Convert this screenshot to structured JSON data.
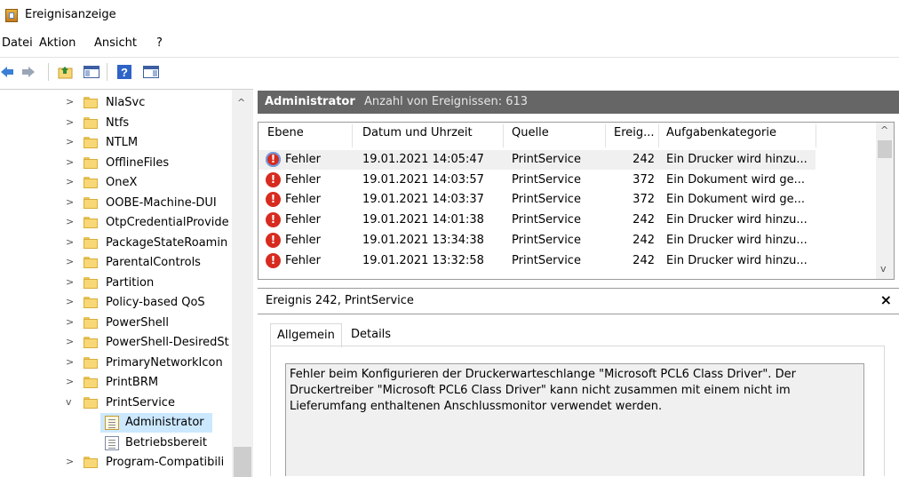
{
  "window": {
    "title": "Ereignisanzeige"
  },
  "menu": [
    "Datei",
    "Aktion",
    "Ansicht",
    "?"
  ],
  "tree": [
    {
      "label": "NlaSvc",
      "chevron": ">"
    },
    {
      "label": "Ntfs",
      "chevron": ">"
    },
    {
      "label": "NTLM",
      "chevron": ">"
    },
    {
      "label": "OfflineFiles",
      "chevron": ">"
    },
    {
      "label": "OneX",
      "chevron": ">"
    },
    {
      "label": "OOBE-Machine-DUI",
      "chevron": ">"
    },
    {
      "label": "OtpCredentialProvide",
      "chevron": ">"
    },
    {
      "label": "PackageStateRoamin",
      "chevron": ">"
    },
    {
      "label": "ParentalControls",
      "chevron": ">"
    },
    {
      "label": "Partition",
      "chevron": ">"
    },
    {
      "label": "Policy-based QoS",
      "chevron": ">"
    },
    {
      "label": "PowerShell",
      "chevron": ">"
    },
    {
      "label": "PowerShell-DesiredSt",
      "chevron": ">"
    },
    {
      "label": "PrimaryNetworkIcon",
      "chevron": ">"
    },
    {
      "label": "PrintBRM",
      "chevron": ">"
    },
    {
      "label": "PrintService",
      "chevron": "v"
    },
    {
      "label": "Administrator",
      "chevron": "",
      "log": true,
      "selected": true
    },
    {
      "label": "Betriebsbereit",
      "chevron": "",
      "log": true
    },
    {
      "label": "Program-Compatibili",
      "chevron": ">"
    }
  ],
  "log_header": {
    "title": "Administrator",
    "count": "Anzahl von Ereignissen: 613"
  },
  "columns": [
    "Ebene",
    "Datum und Uhrzeit",
    "Quelle",
    "Ereig...",
    "Aufgabenkategorie"
  ],
  "events": [
    {
      "level": "Fehler",
      "datetime": "19.01.2021 14:05:47",
      "source": "PrintService",
      "id": "242",
      "category": "Ein Drucker wird hinzu..."
    },
    {
      "level": "Fehler",
      "datetime": "19.01.2021 14:03:57",
      "source": "PrintService",
      "id": "372",
      "category": "Ein Dokument wird ge..."
    },
    {
      "level": "Fehler",
      "datetime": "19.01.2021 14:03:37",
      "source": "PrintService",
      "id": "372",
      "category": "Ein Dokument wird ge..."
    },
    {
      "level": "Fehler",
      "datetime": "19.01.2021 14:01:38",
      "source": "PrintService",
      "id": "242",
      "category": "Ein Drucker wird hinzu..."
    },
    {
      "level": "Fehler",
      "datetime": "19.01.2021 13:34:38",
      "source": "PrintService",
      "id": "242",
      "category": "Ein Drucker wird hinzu..."
    },
    {
      "level": "Fehler",
      "datetime": "19.01.2021 13:32:58",
      "source": "PrintService",
      "id": "242",
      "category": "Ein Drucker wird hinzu..."
    }
  ],
  "detail": {
    "title": "Ereignis 242, PrintService",
    "close": "×",
    "tabs": [
      "Allgemein",
      "Details"
    ],
    "description": "Fehler beim Konfigurieren der Druckerwarteschlange \"Microsoft PCL6 Class Driver\". Der Druckertreiber \"Microsoft PCL6 Class Driver\" kann nicht zusammen mit einem nicht im Lieferumfang enthaltenen Anschlussmonitor verwendet werden."
  },
  "icons": {
    "error": "error-icon",
    "folder": "folder-icon",
    "log": "log-icon",
    "app": "event-viewer-icon"
  },
  "colors": {
    "header_bg": "#666666",
    "selection": "#cce8ff",
    "error": "#d72b1f",
    "folder": "#f8d876"
  }
}
